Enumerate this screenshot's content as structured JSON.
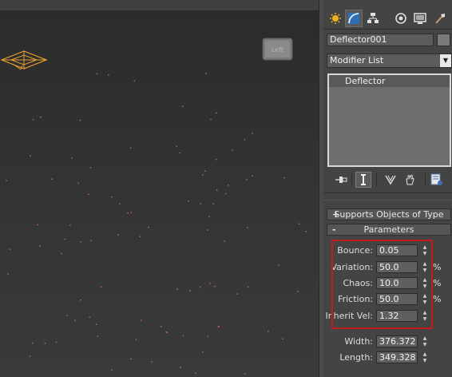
{
  "viewport": {
    "viewcube_label": "Left",
    "colors": {
      "emitter": "#e8a030",
      "particle": "#c4605c"
    }
  },
  "command_panel": {
    "tabs": [
      {
        "name": "create-tab-icon"
      },
      {
        "name": "modify-tab-icon"
      },
      {
        "name": "hierarchy-tab-icon"
      },
      {
        "name": "motion-tab-icon"
      },
      {
        "name": "display-tab-icon"
      },
      {
        "name": "utilities-tab-icon"
      }
    ],
    "object_name": "Deflector001",
    "modifier_list": "Modifier List",
    "stack_items": [
      "Deflector"
    ],
    "rollouts": {
      "supports": {
        "sign": "+",
        "title": "Supports Objects of Type"
      },
      "parameters": {
        "sign": "-",
        "title": "Parameters"
      }
    },
    "parameters": [
      {
        "label": "Bounce:",
        "value": "0.05",
        "unit": ""
      },
      {
        "label": "Variation:",
        "value": "50.0",
        "unit": "%"
      },
      {
        "label": "Chaos:",
        "value": "10.0",
        "unit": "%"
      },
      {
        "label": "Friction:",
        "value": "50.0",
        "unit": "%"
      },
      {
        "label": "Inherit Vel:",
        "value": "1.32",
        "unit": ""
      }
    ],
    "dimensions": [
      {
        "label": "Width:",
        "value": "376.372"
      },
      {
        "label": "Length:",
        "value": "349.328"
      }
    ],
    "highlight_color": "#c41b1b"
  }
}
